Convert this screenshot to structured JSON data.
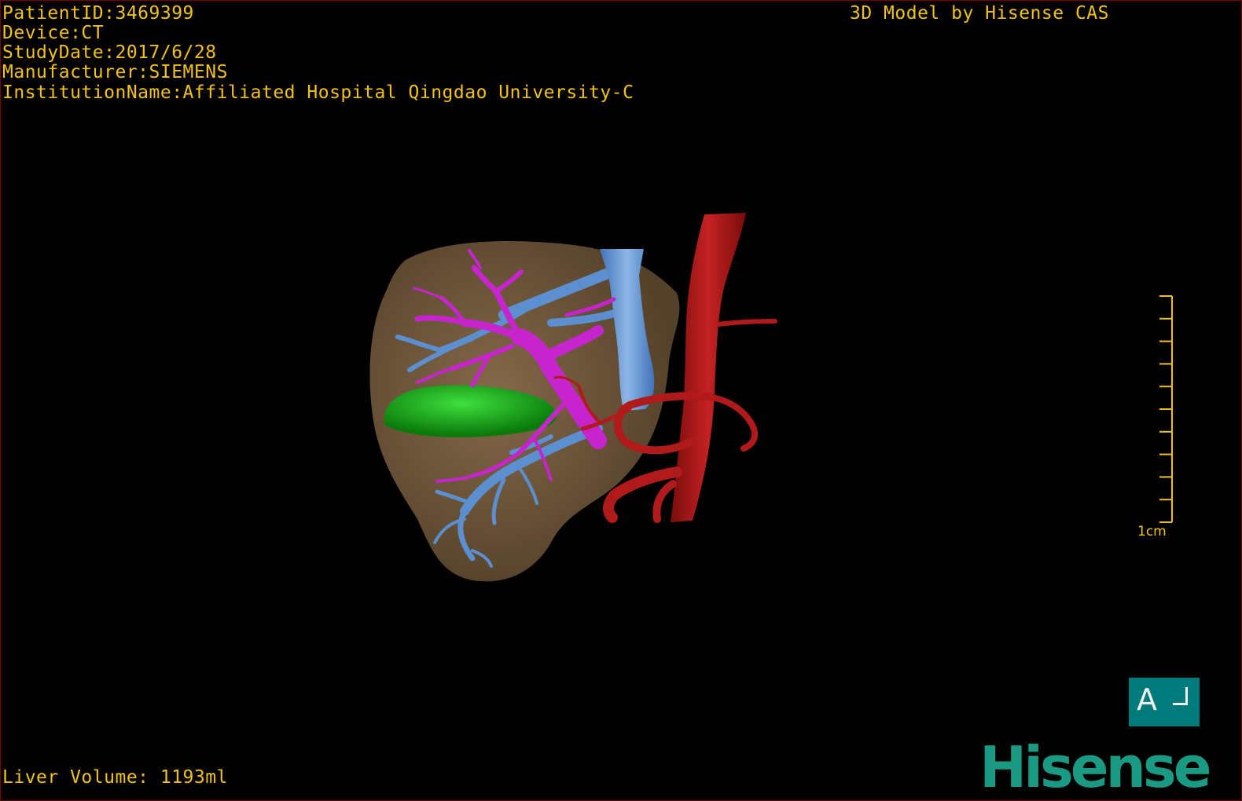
{
  "overlay": {
    "patient_id": "PatientID:3469399",
    "device": "Device:CT",
    "study_date": "StudyDate:2017/6/28",
    "manufacturer": "Manufacturer:SIEMENS",
    "institution": "InstitutionName:Affiliated Hospital Qingdao University-C",
    "model_credit": "3D Model by Hisense CAS",
    "liver_volume": "Liver Volume: 1193ml"
  },
  "scale_bar": {
    "label": "1cm",
    "tick_count": 10
  },
  "orientation": {
    "label": "A"
  },
  "brand": {
    "name": "Hisense"
  },
  "colors": {
    "text_overlay": "#f2c21a",
    "liver": "#6b5537",
    "portal_vein": "#c624cc",
    "hepatic_vein": "#5b8fd0",
    "artery": "#b01a1a",
    "tumor": "#18a818",
    "orientation_bg": "#007a7a",
    "brand": "#1a9a82"
  }
}
